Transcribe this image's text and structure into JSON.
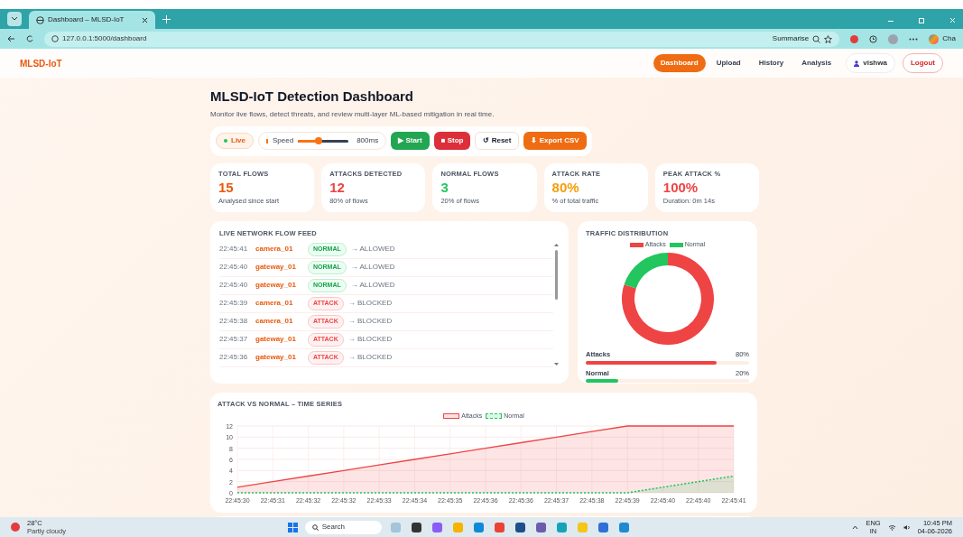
{
  "browser": {
    "tab_title": "Dashboard – MLSD-IoT",
    "url": "127.0.0.1:5000/dashboard",
    "summarise": "Summarise",
    "profile": "Cha"
  },
  "nav": {
    "brand": "MLSD-IoT",
    "links": [
      {
        "label": "Dashboard",
        "selected": true
      },
      {
        "label": "Upload",
        "selected": false
      },
      {
        "label": "History",
        "selected": false
      },
      {
        "label": "Analysis",
        "selected": false
      }
    ],
    "user": "vishwa",
    "logout": "Logout"
  },
  "header": {
    "title": "MLSD-IoT Detection Dashboard",
    "subtitle": "Monitor live flows, detect threats, and review multi-layer ML-based mitigation in real time."
  },
  "controls": {
    "live": "Live",
    "speed_label": "Speed",
    "speed": {
      "level": 0.4
    },
    "speed_value": "800ms",
    "buttons": [
      {
        "label": "▶ Start",
        "kind": "start"
      },
      {
        "label": "■ Stop",
        "kind": "stop"
      },
      {
        "label": "↺ Reset",
        "kind": "reset"
      },
      {
        "label": "⬇ Export CSV",
        "kind": "export"
      }
    ]
  },
  "stats": [
    {
      "label": "TOTAL FLOWS",
      "value": "15",
      "sub": "Analysed since start",
      "color": "#ea580c"
    },
    {
      "label": "ATTACKS DETECTED",
      "value": "12",
      "sub": "80% of flows",
      "color": "#ef4444"
    },
    {
      "label": "NORMAL FLOWS",
      "value": "3",
      "sub": "20% of flows",
      "color": "#22c55e"
    },
    {
      "label": "ATTACK RATE",
      "value": "80%",
      "sub": "% of total traffic",
      "color": "#f59e0b"
    },
    {
      "label": "PEAK ATTACK %",
      "value": "100%",
      "sub": "Duration: 0m 14s",
      "color": "#ef4444"
    }
  ],
  "feed": {
    "title": "LIVE NETWORK FLOW FEED",
    "rows": [
      {
        "time": "22:45:41",
        "device": "camera_01",
        "status": "NORMAL",
        "kind": "normal",
        "action": "→ ALLOWED"
      },
      {
        "time": "22:45:40",
        "device": "gateway_01",
        "status": "NORMAL",
        "kind": "normal",
        "action": "→ ALLOWED"
      },
      {
        "time": "22:45:40",
        "device": "gateway_01",
        "status": "NORMAL",
        "kind": "normal",
        "action": "→ ALLOWED"
      },
      {
        "time": "22:45:39",
        "device": "camera_01",
        "status": "ATTACK",
        "kind": "attack",
        "action": "→ BLOCKED"
      },
      {
        "time": "22:45:38",
        "device": "camera_01",
        "status": "ATTACK",
        "kind": "attack",
        "action": "→ BLOCKED"
      },
      {
        "time": "22:45:37",
        "device": "gateway_01",
        "status": "ATTACK",
        "kind": "attack",
        "action": "→ BLOCKED"
      },
      {
        "time": "22:45:36",
        "device": "gateway_01",
        "status": "ATTACK",
        "kind": "attack",
        "action": "→ BLOCKED"
      }
    ]
  },
  "distribution": {
    "title": "TRAFFIC DISTRIBUTION",
    "chart_data": {
      "type": "donut",
      "categories": [
        "Attacks",
        "Normal"
      ],
      "values": [
        80,
        20
      ],
      "colors": [
        "#ef4444",
        "#22c55e"
      ]
    },
    "bars": [
      {
        "label": "Attacks",
        "reading": "80%",
        "level": 0.8,
        "color": "#ef4444"
      },
      {
        "label": "Normal",
        "reading": "20%",
        "level": 0.2,
        "color": "#22c55e"
      }
    ]
  },
  "timeseries": {
    "title": "ATTACK VS NORMAL – TIME SERIES",
    "chart_data": {
      "type": "area",
      "grid": true,
      "x": [
        "22:45:30",
        "22:45:31",
        "22:45:32",
        "22:45:32",
        "22:45:33",
        "22:45:34",
        "22:45:35",
        "22:45:36",
        "22:45:36",
        "22:45:37",
        "22:45:38",
        "22:45:39",
        "22:45:40",
        "22:45:40",
        "22:45:41"
      ],
      "ylim": [
        0,
        12
      ],
      "yticks": [
        0,
        2,
        4,
        6,
        8,
        10,
        12
      ],
      "series": [
        {
          "name": "Attacks",
          "color": "#ef4444",
          "line_style": "solid",
          "values": [
            1,
            2,
            3,
            4,
            5,
            6,
            7,
            8,
            9,
            10,
            11,
            12,
            12,
            12,
            12
          ]
        },
        {
          "name": "Normal",
          "color": "#22c55e",
          "line_style": "dashed",
          "values": [
            0,
            0,
            0,
            0,
            0,
            0,
            0,
            0,
            0,
            0,
            0,
            0,
            1,
            2,
            3
          ]
        }
      ]
    }
  },
  "taskbar": {
    "temp": "28°C",
    "weather": "Partly cloudy",
    "search": "Search",
    "lang": "ENG",
    "region": "IN",
    "time": "10:45 PM",
    "date": "04-06-2026"
  }
}
